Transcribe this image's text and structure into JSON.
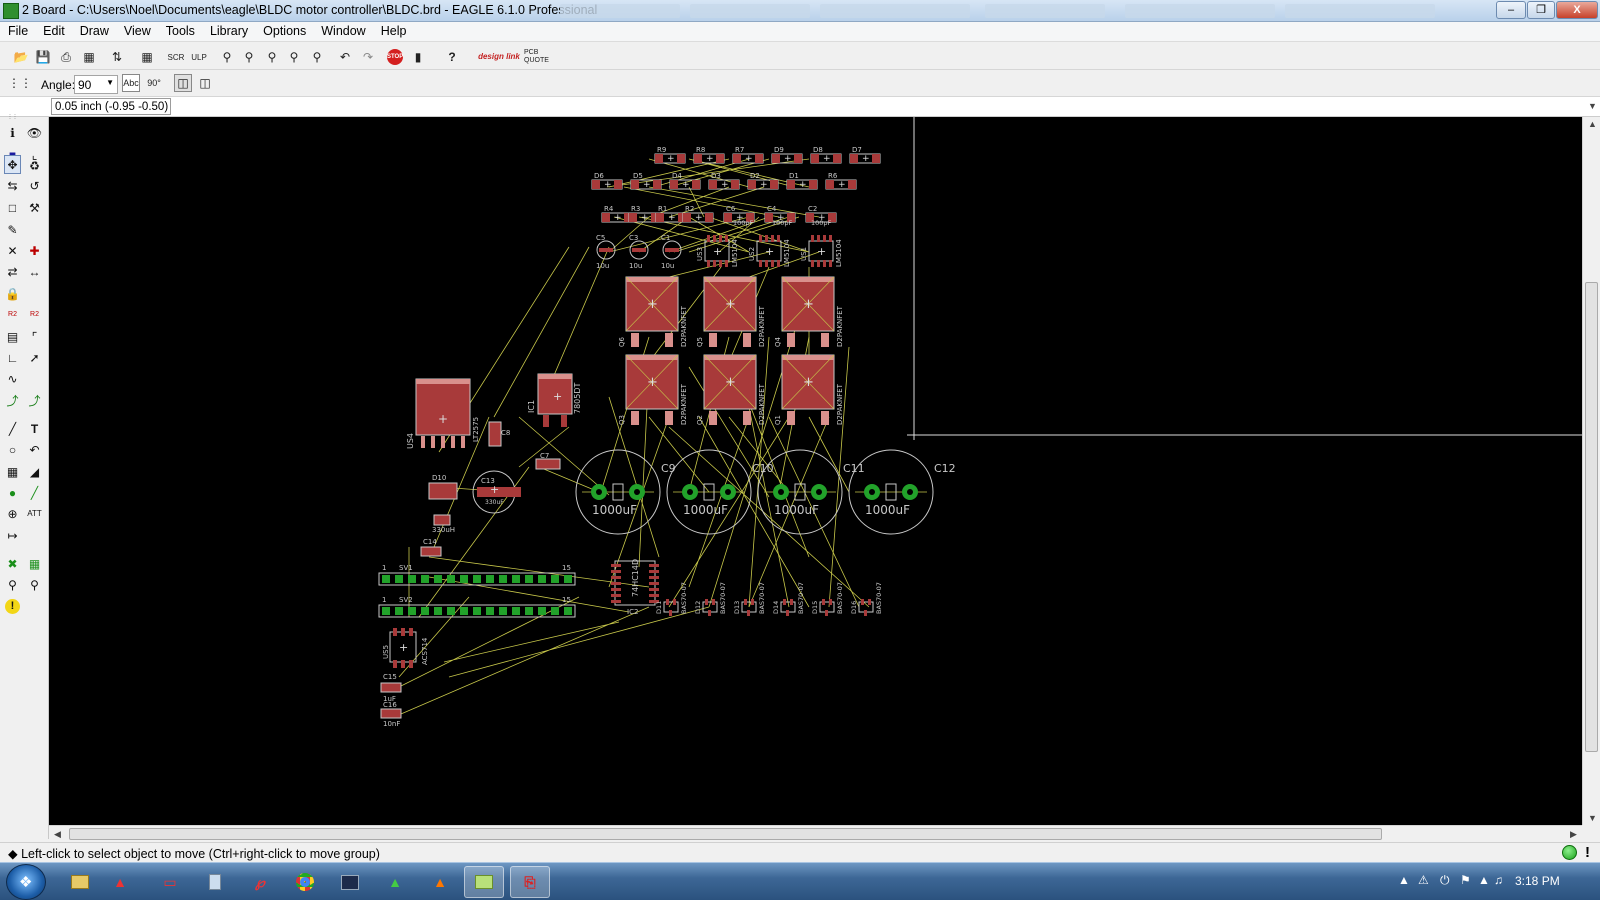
{
  "window": {
    "title": "2 Board - C:\\Users\\Noel\\Documents\\eagle\\BLDC motor controller\\BLDC.brd - EAGLE 6.1.0 Professional",
    "minimize": "–",
    "restore": "❐",
    "close": "X"
  },
  "menu": [
    "File",
    "Edit",
    "Draw",
    "View",
    "Tools",
    "Library",
    "Options",
    "Window",
    "Help"
  ],
  "toolbar": {
    "icons": [
      "open-icon",
      "save-icon",
      "print-icon",
      "cam-icon",
      "script-icon",
      "bom-icon",
      "sch-icon",
      "ulp-icon",
      "zoom-fit-icon",
      "zoom-in-icon",
      "zoom-out-icon",
      "zoom-redraw-icon",
      "zoom-select-icon",
      "undo-icon",
      "redo-icon",
      "stop-icon",
      "go-icon",
      "help-icon",
      "design-link-icon",
      "pcb-quote-icon"
    ],
    "design_link_label": "design link",
    "pcb_quote_label": "PCB QUOTE"
  },
  "parambar": {
    "angle_label": "Angle:",
    "angle_value": "90"
  },
  "coords": {
    "display": "0.05 inch (-0.95 -0.50)"
  },
  "status": {
    "message": "◆ Left-click to select object to move (Ctrl+right-click to move group)",
    "stop_mark": "!"
  },
  "taskbar": {
    "clock": "3:18 PM",
    "apps": [
      "explorer-icon",
      "eagle-red-icon",
      "autodesk-icon",
      "notepad-icon",
      "acrobat-icon",
      "chrome-icon",
      "terminal-icon",
      "eagle-green-icon",
      "matlab-icon",
      "folder-active-icon",
      "pdf-icon"
    ]
  },
  "colors": {
    "canvas": "#000000",
    "pad": "#a83a3a",
    "pad_light": "#d9908c",
    "via": "#22a22a",
    "airwire": "#c7c74a",
    "silkscreen": "#c8c8c8"
  },
  "board": {
    "r_row_top": [
      "R9",
      "R8",
      "R7",
      "D9",
      "D8",
      "D7"
    ],
    "d_row": [
      "D6",
      "D5",
      "D4",
      "D3",
      "D2",
      "D1",
      "R6"
    ],
    "r_row_bottom": [
      "R4",
      "R3",
      "R1",
      "R2",
      "C6",
      "C4",
      "C2"
    ],
    "r_row_bottom_values": [
      "100pF",
      "100pF",
      "100pF"
    ],
    "small_caps": [
      "C5",
      "C3",
      "C1"
    ],
    "small_cap_values": [
      "10u",
      "10u",
      "10u"
    ],
    "drivers": [
      "US3",
      "US2",
      "US1"
    ],
    "driver_part": [
      "LM5104",
      "LM5104",
      "LM5104"
    ],
    "fets": [
      "Q6",
      "Q5",
      "Q4",
      "Q3",
      "Q2",
      "Q1"
    ],
    "fet_part": "D2PAKNFET",
    "regulator": "IC1",
    "regulator_part": "7805DT",
    "module": "US4",
    "module_part": "LT2575",
    "small_parts": [
      "C8",
      "C7",
      "D10",
      "C13",
      "C14",
      "C15",
      "C16"
    ],
    "small_part_values": [
      "330uH",
      "330uF",
      "1uF",
      "10nF"
    ],
    "bulk_caps": [
      "C9",
      "C10",
      "C11",
      "C12"
    ],
    "bulk_cap_value": "1000uF",
    "headers": [
      "SV1",
      "SV2"
    ],
    "header_pin_first": "1",
    "header_pin_last": "15",
    "logic_ic": "IC2",
    "logic_ic_part": "74HC14D",
    "sense_ic": "US5",
    "sense_ic_part": "ACS714",
    "diodes": [
      "D11",
      "D12",
      "D13",
      "D14",
      "D15",
      "D16"
    ],
    "diode_part": "BAS70-07"
  }
}
